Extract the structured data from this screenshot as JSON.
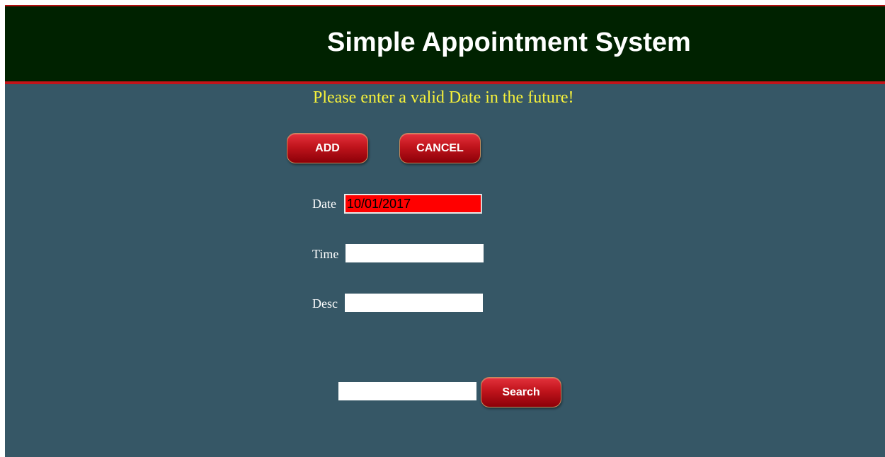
{
  "header": {
    "title": "Simple Appointment System"
  },
  "message": {
    "error_text": "Please enter a valid Date in the future!"
  },
  "actions": {
    "add_label": "ADD",
    "cancel_label": "CANCEL"
  },
  "form": {
    "date": {
      "label": "Date",
      "value": "10/01/2017",
      "invalid_highlight_color": "#ff0000"
    },
    "time": {
      "label": "Time",
      "value": ""
    },
    "desc": {
      "label": "Desc",
      "value": ""
    }
  },
  "search": {
    "value": "",
    "button_label": "Search"
  },
  "colors": {
    "header_background": "#002200",
    "page_background": "#365766",
    "accent_red": "#c3141a",
    "message_yellow": "#f7f23a"
  }
}
